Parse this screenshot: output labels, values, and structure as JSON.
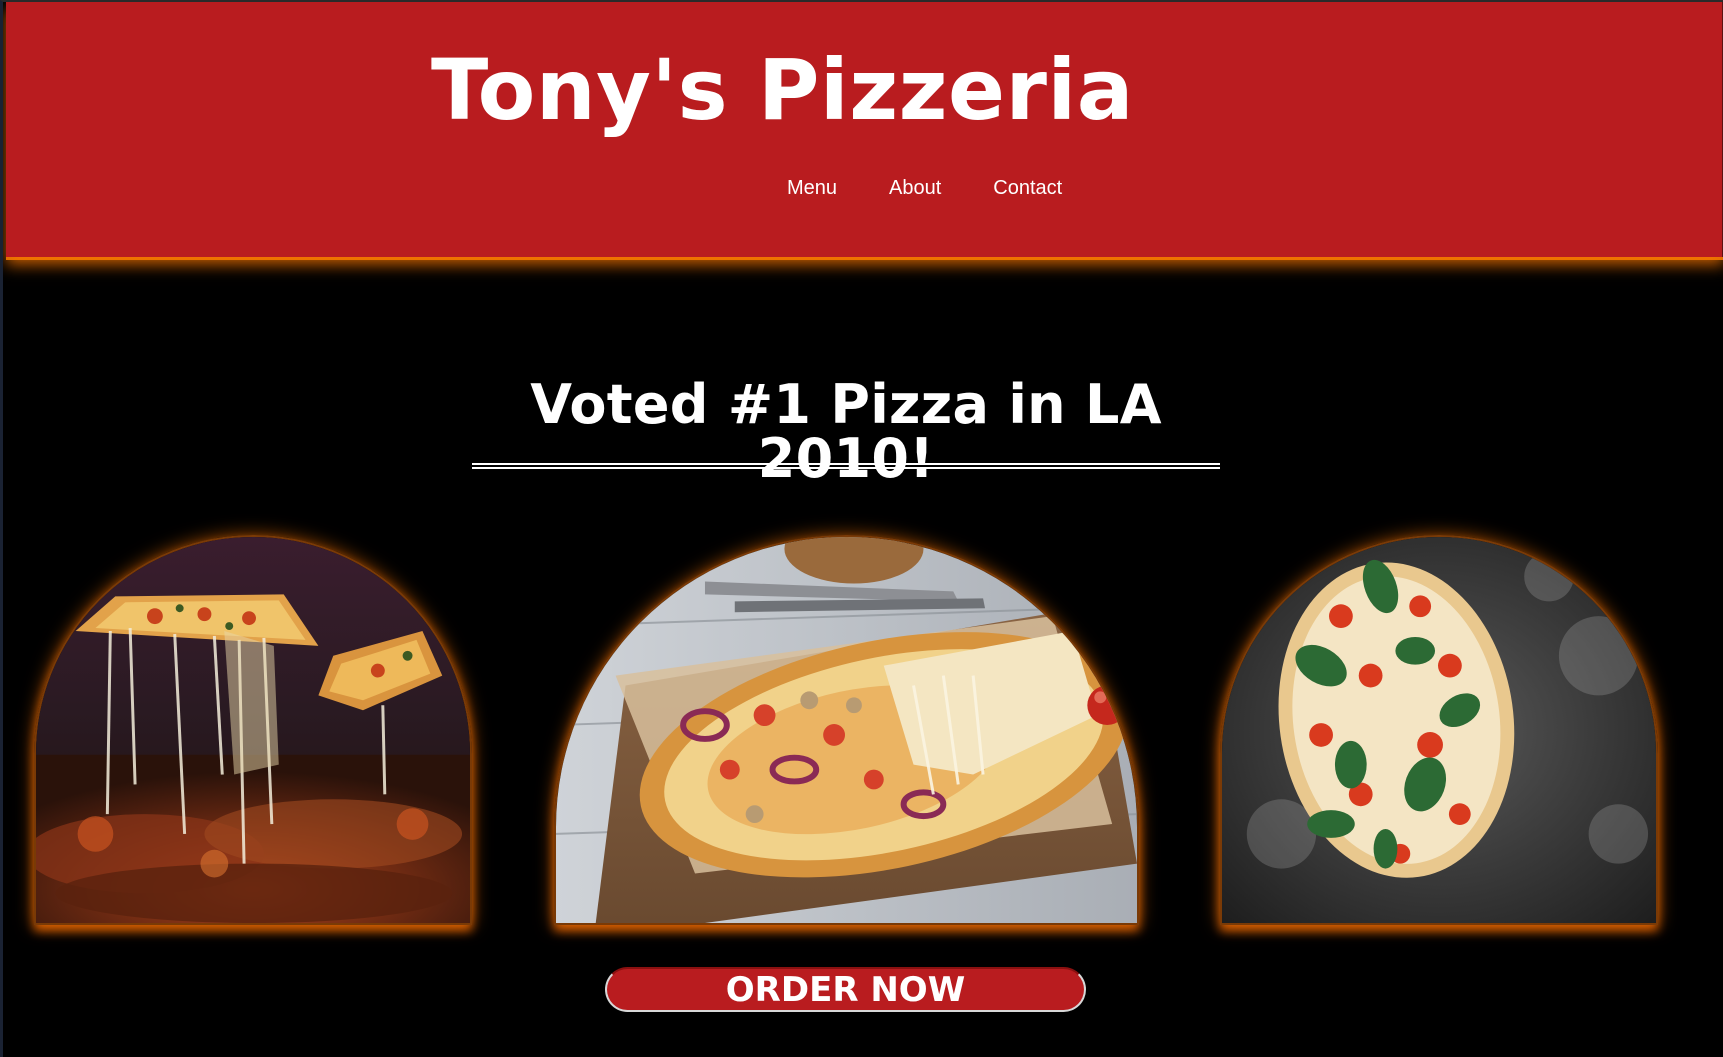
{
  "header": {
    "brand": "Tony's Pizzeria",
    "nav": [
      "Menu",
      "About",
      "Contact"
    ]
  },
  "hero": {
    "headline": "Voted #1 Pizza in LA 2010!"
  },
  "gallery": {
    "images": [
      {
        "subject": "pizza-slice-cheese-pull"
      },
      {
        "subject": "pizza-on-wooden-board"
      },
      {
        "subject": "margherita-pizza-dark-surface"
      }
    ]
  },
  "cta": {
    "label": "ORDER NOW"
  },
  "colors": {
    "brand_red": "#b91c1f",
    "glow_orange": "#ff7800",
    "background": "#000000",
    "text": "#ffffff"
  }
}
